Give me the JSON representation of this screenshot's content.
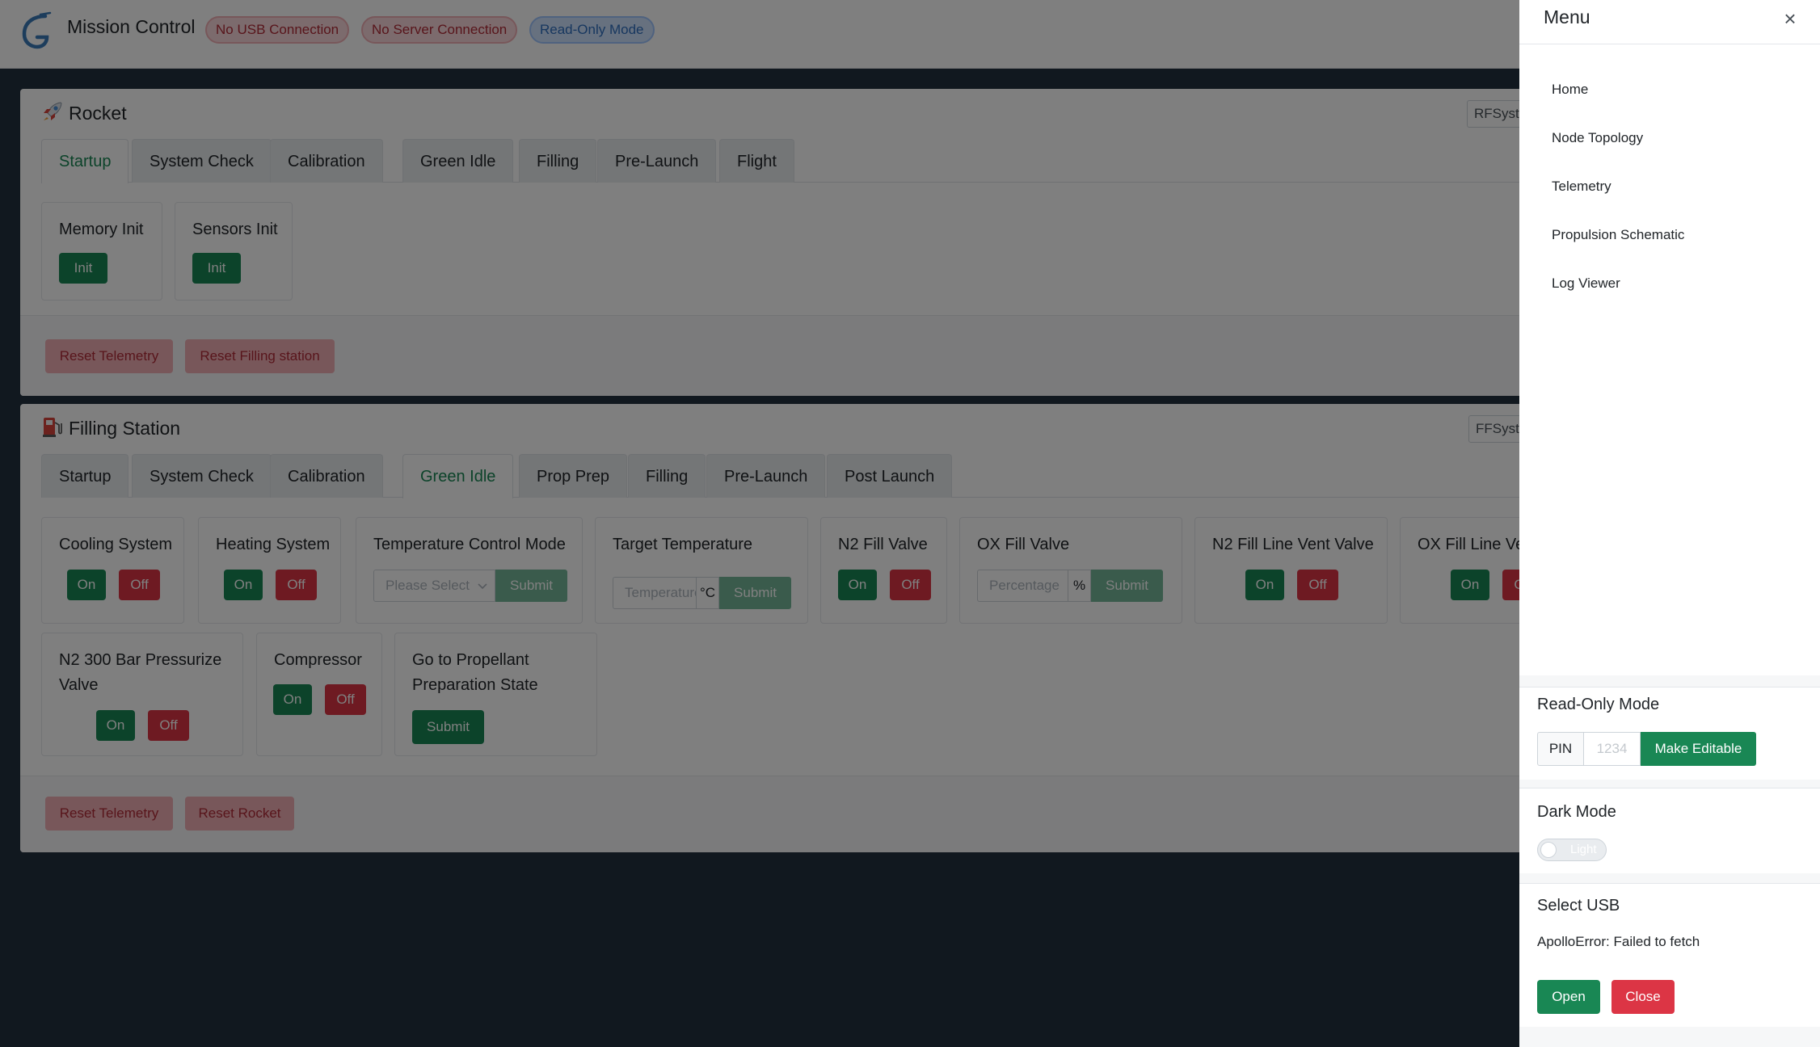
{
  "header": {
    "app_title": "Mission Control",
    "badges": [
      "No USB Connection",
      "No Server Connection",
      "Read-Only Mode"
    ]
  },
  "rocket": {
    "title": "Rocket",
    "param_box": "RFSystemPa",
    "tabs": [
      "Startup",
      "System Check",
      "Calibration",
      "Green Idle",
      "Filling",
      "Pre-Launch",
      "Flight"
    ],
    "active_tab": "Startup",
    "panels": [
      {
        "title": "Memory Init",
        "button": "Init"
      },
      {
        "title": "Sensors Init",
        "button": "Init"
      }
    ],
    "footer_buttons": [
      "Reset Telemetry",
      "Reset Filling station"
    ]
  },
  "filling": {
    "title": "Filling Station",
    "param_box": "FFSystemPa",
    "tabs": [
      "Startup",
      "System Check",
      "Calibration",
      "Green Idle",
      "Prop Prep",
      "Filling",
      "Pre-Launch",
      "Post Launch"
    ],
    "active_tab": "Green Idle",
    "on_label": "On",
    "off_label": "Off",
    "submit_label": "Submit",
    "panels": {
      "cooling": "Cooling System",
      "heating": "Heating System",
      "temp_mode": "Temperature Control Mode",
      "temp_mode_placeholder": "Please Select",
      "target_temp": "Target Temperature",
      "target_temp_placeholder": "Temperature",
      "temp_unit": "°C",
      "n2_fill": "N2 Fill Valve",
      "ox_fill": "OX Fill Valve",
      "ox_fill_placeholder": "Percentage",
      "pct_unit": "%",
      "n2_vent": "N2 Fill Line Vent Valve",
      "ox_vent": "OX Fill Line Vent Valve",
      "n2_300": "N2 300 Bar Pressurize Valve",
      "compressor": "Compressor",
      "go_prop": "Go to Propellant Preparation State"
    },
    "footer_buttons": [
      "Reset Telemetry",
      "Reset Rocket"
    ]
  },
  "menu": {
    "title": "Menu",
    "close_icon": "×",
    "items": [
      "Home",
      "Node Topology",
      "Telemetry",
      "Propulsion Schematic",
      "Log Viewer"
    ],
    "read_only": {
      "title": "Read-Only Mode",
      "pin_label": "PIN",
      "pin_placeholder": "1234",
      "make_editable": "Make Editable"
    },
    "dark_mode": {
      "title": "Dark Mode",
      "toggle_label": "Light"
    },
    "usb": {
      "title": "Select USB",
      "error": "ApolloError: Failed to fetch",
      "open": "Open",
      "close": "Close"
    }
  },
  "colors": {
    "success": "#198754",
    "danger": "#dc3545",
    "page_bg": "#22303f"
  }
}
